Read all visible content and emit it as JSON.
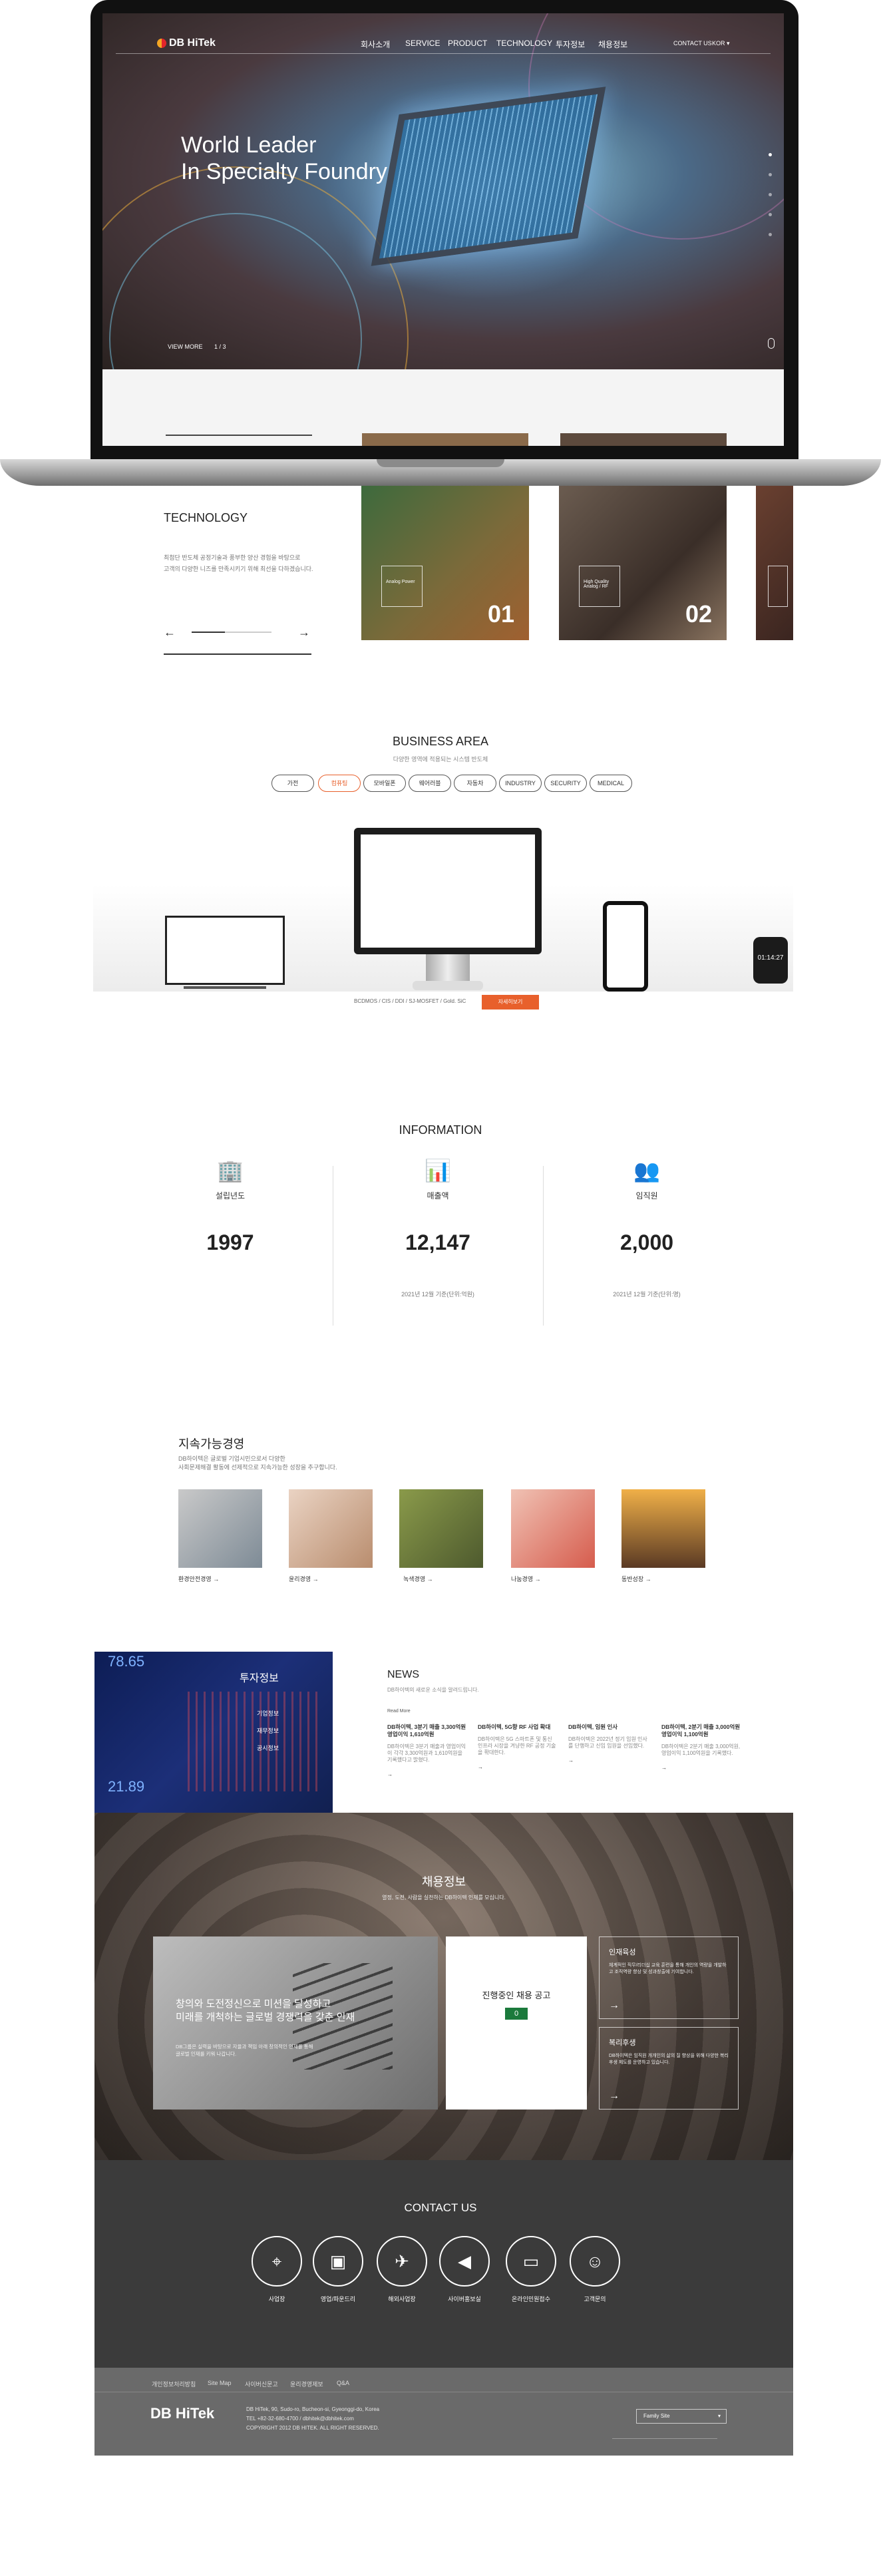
{
  "hero": {
    "brand": "DB HiTek",
    "nav": [
      "회사소개",
      "SERVICE",
      "PRODUCT",
      "TECHNOLOGY",
      "투자정보",
      "채용정보"
    ],
    "contact_us": "CONTACT US",
    "lang": "KOR",
    "title_line1": "World Leader",
    "title_line2": "In Specialty Foundry",
    "view_more": "VIEW MORE",
    "pager": "1 / 3",
    "slide_count": 5,
    "active_slide": 1
  },
  "technology": {
    "title": "TECHNOLOGY",
    "desc1": "최첨단 반도체 공정기술과 풍부한 양산 경험을 바탕으로",
    "desc2": "고객의 다양한 니즈를 만족시키기 위해 최선을 다하겠습니다.",
    "cards": [
      {
        "num": "01",
        "box": "Analog Power"
      },
      {
        "num": "02",
        "box": "High Quality Analog / RF"
      },
      {
        "num": "03",
        "box": ""
      }
    ]
  },
  "business": {
    "title": "BUSINESS AREA",
    "subtitle": "다양한 영역에 적용되는 시스템 반도체",
    "tabs": [
      "가전",
      "컴퓨팅",
      "모바일폰",
      "웨어러블",
      "자동차",
      "INDUSTRY",
      "SECURITY",
      "MEDICAL"
    ],
    "active_tab": 1,
    "caption": "BCDMOS / CIS / DDI / SJ-MOSFET / Gold. SiC",
    "more": "자세히보기",
    "watch_time": "01:14:27"
  },
  "information": {
    "title": "INFORMATION",
    "items": [
      {
        "label": "설립년도",
        "value": "1997",
        "note": ""
      },
      {
        "label": "매출액",
        "value": "12,147",
        "note": "2021년 12월 기준(단위:억원)"
      },
      {
        "label": "임직원",
        "value": "2,000",
        "note": "2021년 12월 기준(단위:명)"
      }
    ]
  },
  "sustainability": {
    "title": "지속가능경영",
    "desc1": "DB하이텍은 글로벌 기업시민으로서 다양한",
    "desc2": "사회문제해결 활동에 선제적으로 지속가능한 성장을 추구합니다.",
    "items": [
      "환경안전경영",
      "윤리경영",
      "녹색경영",
      "나눔경영",
      "동반성장"
    ]
  },
  "invest": {
    "title": "투자정보",
    "links": [
      "기업정보",
      "재무정보",
      "공시정보"
    ],
    "ticker1": "78.65",
    "ticker2": "21.89"
  },
  "news": {
    "title": "NEWS",
    "subtitle": "DB하이텍의 새로운 소식을 알려드립니다.",
    "more": "Read More",
    "items": [
      {
        "title": "DB하이텍, 3분기 매출 3,300억원 영업이익 1,610억원",
        "body": "DB하이텍은 3분기 매출과 영업이익이 각각 3,300억원과 1,610억원을 기록했다고 밝혔다."
      },
      {
        "title": "DB하이텍, 5G향 RF 사업 확대",
        "body": "DB하이텍은 5G 스마트폰 및 통신 인프라 시장을 겨냥한 RF 공정 기술을 확대한다."
      },
      {
        "title": "DB하이텍, 임원 인사",
        "body": "DB하이텍은 2022년 정기 임원 인사를 단행하고 신임 임원을 선임했다."
      },
      {
        "title": "DB하이텍, 2분기 매출 3,000억원 영업이익 1,100억원",
        "body": "DB하이텍은 2분기 매출 3,000억원, 영업이익 1,100억원을 기록했다."
      }
    ]
  },
  "recruit": {
    "title": "채용정보",
    "subtitle": "열정, 도전, 사람을 실천하는 DB하이텍 인재를 모십니다.",
    "main_title1": "창의와 도전정신으로 미션을 달성하고",
    "main_title2": "미래를 개척하는 글로벌 경쟁력을 갖춘 인재",
    "main_body1": "DB그룹은 실력을 바탕으로 자율과 책임 아래 창의적인 인재를 통해",
    "main_body2": "글로벌 인재를 키워 나갑니다.",
    "jobs_title": "진행중인 채용 공고",
    "jobs_count": "0",
    "card1_title": "인재육성",
    "card1_body": "체계적인 직무/리더십 교육 훈련을 통해 개인의 역량을 개발하고 조직역량 향상 및 성과창출에 기여합니다.",
    "card2_title": "복리후생",
    "card2_body": "DB하이텍은 임직원 개개인의 삶의 질 향상을 위해 다양한 복리후생 제도를 운영하고 있습니다."
  },
  "contact": {
    "title": "CONTACT US",
    "items": [
      "사업장",
      "영업/파운드리",
      "해외사업장",
      "사이버홍보실",
      "온라인민원접수",
      "고객문의"
    ]
  },
  "footer": {
    "links": [
      "개인정보처리방침",
      "Site Map",
      "사이버신문고",
      "윤리경영제보",
      "Q&A"
    ],
    "brand": "DB HiTek",
    "address": "DB HiTek, 90, Sudo-ro, Bucheon-si, Gyeonggi-do, Korea",
    "phone": "TEL +82-32-680-4700 / dbhitek@dbhitek.com",
    "copyright": "COPYRIGHT 2012 DB HITEK. ALL RIGHT RESERVED.",
    "family": "Family Site"
  }
}
